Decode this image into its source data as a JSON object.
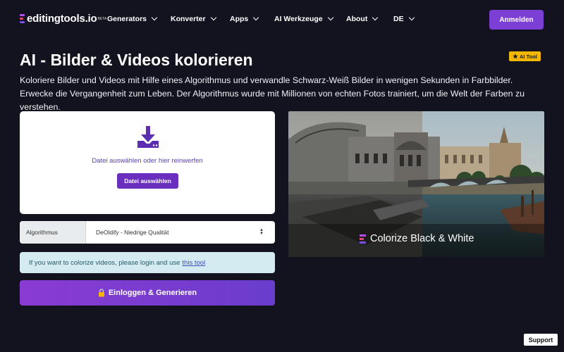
{
  "brand": {
    "logo_text": "editingtools.io",
    "logo_sup": "BETA"
  },
  "nav": {
    "items": [
      {
        "label": "Generators"
      },
      {
        "label": "Konverter"
      },
      {
        "label": "Apps"
      },
      {
        "label": "AI Werkzeuge"
      },
      {
        "label": "About"
      },
      {
        "label": "DE"
      }
    ],
    "login_label": "Anmelden"
  },
  "page": {
    "title": "AI - Bilder & Videos kolorieren",
    "badge": "AI Tool",
    "badge_icon": "star-icon",
    "description": "Koloriere Bilder und Videos mit Hilfe eines Algorithmus und verwandle Schwarz-Weiß Bilder in wenigen Sekunden in Farbbilder. Erwecke die Vergangenheit zum Leben. Der Algorithmus wurde mit Millionen von echten Fotos trainiert, um die Welt der Farben zu verstehen."
  },
  "upload": {
    "icon": "download-icon",
    "drop_text": "Datei auswählen oder hier reinwerfen",
    "button_label": "Datei auswählen"
  },
  "algorithm": {
    "label": "Algorithmus",
    "selected": "DeOldify - Niedrige Qualität"
  },
  "info": {
    "text": "If you want to colorize videos, please login and use",
    "link_text": "this tool"
  },
  "generate": {
    "icon": "lock-icon",
    "label": "Einloggen & Generieren"
  },
  "preview": {
    "caption": "Colorize Black & White"
  },
  "support_label": "Support",
  "colors": {
    "background": "#131320",
    "accent": "#7b3fd6",
    "badge": "#f2b705",
    "info_bg": "#d4ecf1"
  }
}
